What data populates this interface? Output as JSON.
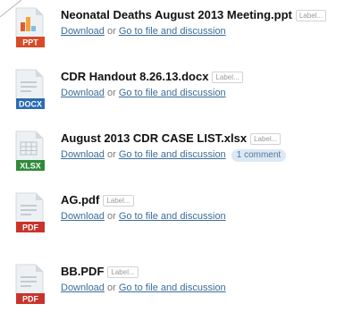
{
  "files": [
    {
      "name": "Neonatal Deaths August 2013 Meeting.ppt",
      "type_badge": "PPT",
      "badge_color": "#d84a27",
      "icon": "powerpoint-file-icon",
      "label_tag": "Label...",
      "download_label": "Download",
      "or_text": "or",
      "discussion_label": "Go to file and discussion",
      "comments": null
    },
    {
      "name": "CDR Handout 8.26.13.docx",
      "type_badge": "DOCX",
      "badge_color": "#2a6bb3",
      "icon": "word-file-icon",
      "label_tag": "Label...",
      "download_label": "Download",
      "or_text": "or",
      "discussion_label": "Go to file and discussion",
      "comments": null
    },
    {
      "name": "August 2013 CDR CASE LIST.xlsx",
      "type_badge": "XLSX",
      "badge_color": "#2f8a3a",
      "icon": "excel-file-icon",
      "label_tag": "Label...",
      "download_label": "Download",
      "or_text": "or",
      "discussion_label": "Go to file and discussion",
      "comments": "1 comment"
    },
    {
      "name": "AG.pdf",
      "type_badge": "PDF",
      "badge_color": "#c9332b",
      "icon": "pdf-file-icon",
      "label_tag": "Label...",
      "download_label": "Download",
      "or_text": "or",
      "discussion_label": "Go to file and discussion",
      "comments": null
    },
    {
      "name": "BB.PDF",
      "type_badge": "PDF",
      "badge_color": "#c9332b",
      "icon": "pdf-file-icon",
      "label_tag": "Label...",
      "download_label": "Download",
      "or_text": "or",
      "discussion_label": "Go to file and discussion",
      "comments": null
    }
  ]
}
